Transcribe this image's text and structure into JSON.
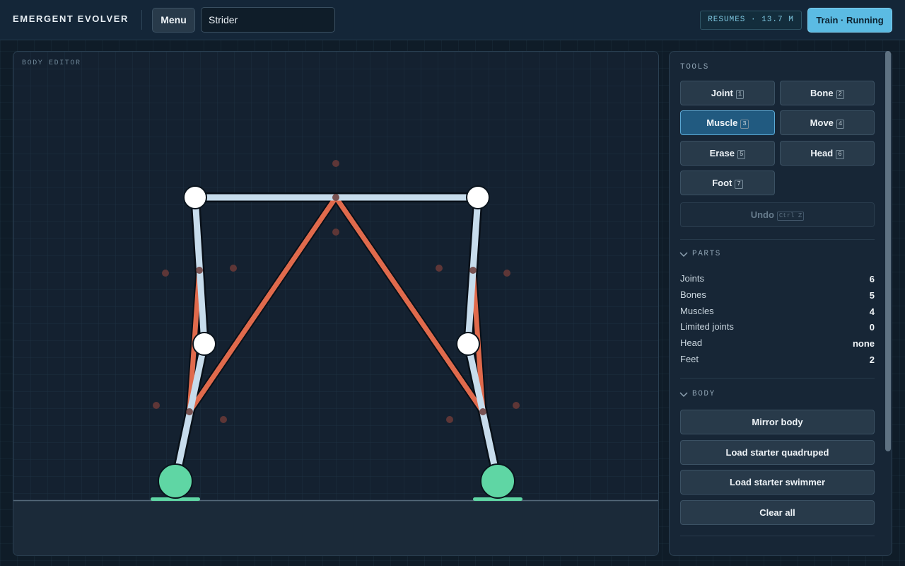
{
  "header": {
    "title": "EMERGENT EVOLVER",
    "menu_label": "Menu",
    "creature_name": "Strider",
    "resumes": "RESUMES · 13.7 M",
    "train_label": "Train · Running"
  },
  "editor": {
    "label": "BODY EDITOR"
  },
  "tools": {
    "label": "TOOLS",
    "items": [
      {
        "label": "Joint",
        "key": "1"
      },
      {
        "label": "Bone",
        "key": "2"
      },
      {
        "label": "Muscle",
        "key": "3"
      },
      {
        "label": "Move",
        "key": "4"
      },
      {
        "label": "Erase",
        "key": "5"
      },
      {
        "label": "Head",
        "key": "6"
      },
      {
        "label": "Foot",
        "key": "7"
      }
    ],
    "active": "Muscle",
    "undo_label": "Undo",
    "undo_key": "Ctrl Z"
  },
  "parts": {
    "label": "PARTS",
    "rows": [
      {
        "label": "Joints",
        "value": "6"
      },
      {
        "label": "Bones",
        "value": "5"
      },
      {
        "label": "Muscles",
        "value": "4"
      },
      {
        "label": "Limited joints",
        "value": "0"
      },
      {
        "label": "Head",
        "value": "none"
      },
      {
        "label": "Feet",
        "value": "2"
      }
    ]
  },
  "body": {
    "label": "BODY",
    "buttons": [
      "Mirror body",
      "Load starter quadruped",
      "Load starter swimmer",
      "Clear all"
    ]
  },
  "colors": {
    "bone": "#c7dcec",
    "muscle": "#e06a4c",
    "joint": "#ffffff",
    "foot": "#5fd6a4",
    "accent": "#5bbbe3"
  }
}
